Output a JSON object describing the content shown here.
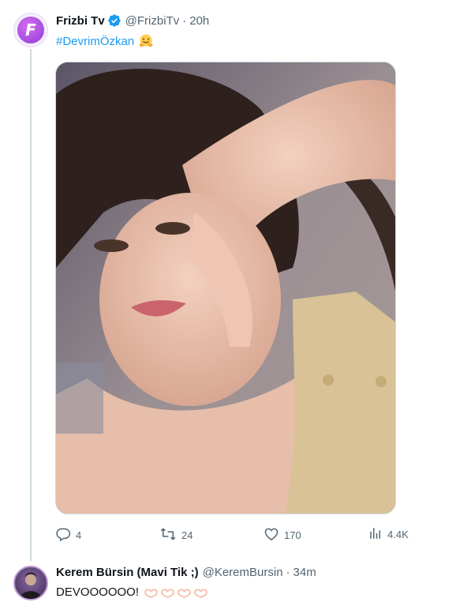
{
  "tweet": {
    "author_name": "Frizbi Tv",
    "author_handle": "@FrizbiTv",
    "separator": "·",
    "time": "20h",
    "avatar_letter": "F",
    "hashtag": "#DevrimÖzkan",
    "emoji_icon": "hugging-face-emoji",
    "image_alt": "selfie photo",
    "actions": {
      "reply_count": "4",
      "retweet_count": "24",
      "like_count": "170",
      "views_count": "4.4K"
    }
  },
  "reply": {
    "author_name": "Kerem Bürsin (Mavi Tik ;)",
    "author_handle": "@KeremBursin",
    "separator": "·",
    "time": "34m",
    "text": "DEVOOOOOO!",
    "hearts_icon": "hand-heart-emoji"
  },
  "colors": {
    "accent": "#1d9bf0",
    "muted": "#536471",
    "text": "#0f1419",
    "border": "#cfd9de"
  }
}
